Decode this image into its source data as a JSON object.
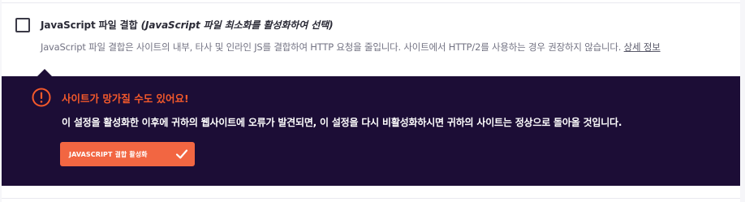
{
  "option": {
    "title": "JavaScript 파일 결합",
    "title_note": "(JavaScript 파일 최소화를 활성화하여 선택)",
    "description": "JavaScript 파일 결합은 사이트의 내부, 타사 및 인라인 JS를 결합하여 HTTP 요청을 줄입니다. 사이트에서 HTTP/2를 사용하는 경우 권장하지 않습니다.",
    "more_link": "상세 정보",
    "checked": false
  },
  "warning": {
    "title": "사이트가 망가질 수도 있어요!",
    "body": "이 설정을 활성화한 이후에 귀하의 웹사이트에 오류가 발견되면, 이 설정을 다시 비활성화하시면 귀하의 사이트는 정상으로 돌아올 것입니다.",
    "button_label": "JAVASCRIPT 결합 활성화",
    "icon": "exclamation-circle-icon",
    "button_icon": "checkmark-icon"
  },
  "colors": {
    "warning_bg": "#1c0d36",
    "warning_accent": "#f4592b",
    "button_bg": "#f26642"
  }
}
